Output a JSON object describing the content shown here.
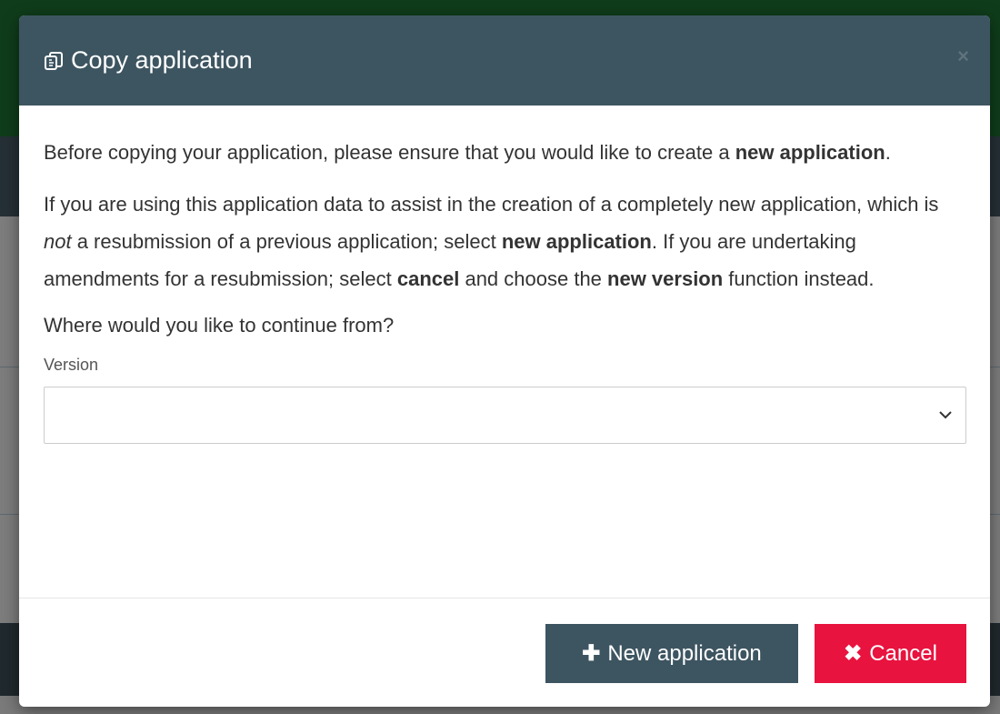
{
  "modal": {
    "title": "Copy application",
    "close_glyph": "×",
    "intro_text": "Before copying your application, please ensure that you would like to create a ",
    "intro_bold": "new application",
    "intro_end": ".",
    "body_part1": "If you are using this application data to assist in the creation of a completely new application, which is ",
    "body_italic": "not",
    "body_part2": " a resubmission of a previous application; select ",
    "body_bold1": "new application",
    "body_part3": ". If you are undertaking amendments for a resubmission; select ",
    "body_bold2": "cancel",
    "body_part4": " and choose the ",
    "body_bold3": "new version",
    "body_part5": " function instead.",
    "question": "Where would you like to continue from?",
    "version_label": "Version",
    "version_value": ""
  },
  "footer": {
    "new_button_icon": "✚",
    "new_button_label": "New application",
    "cancel_button_icon": "✖",
    "cancel_button_label": "Cancel"
  },
  "icons": {
    "title_icon": "copy-icon",
    "close_icon": "close-icon",
    "chevron_icon": "chevron-down-icon",
    "new_button_icon": "plus-icon",
    "cancel_button_icon": "x-icon"
  },
  "colors": {
    "header_bg": "#3d5561",
    "primary_button": "#3d5561",
    "cancel_button": "#e8133f"
  }
}
